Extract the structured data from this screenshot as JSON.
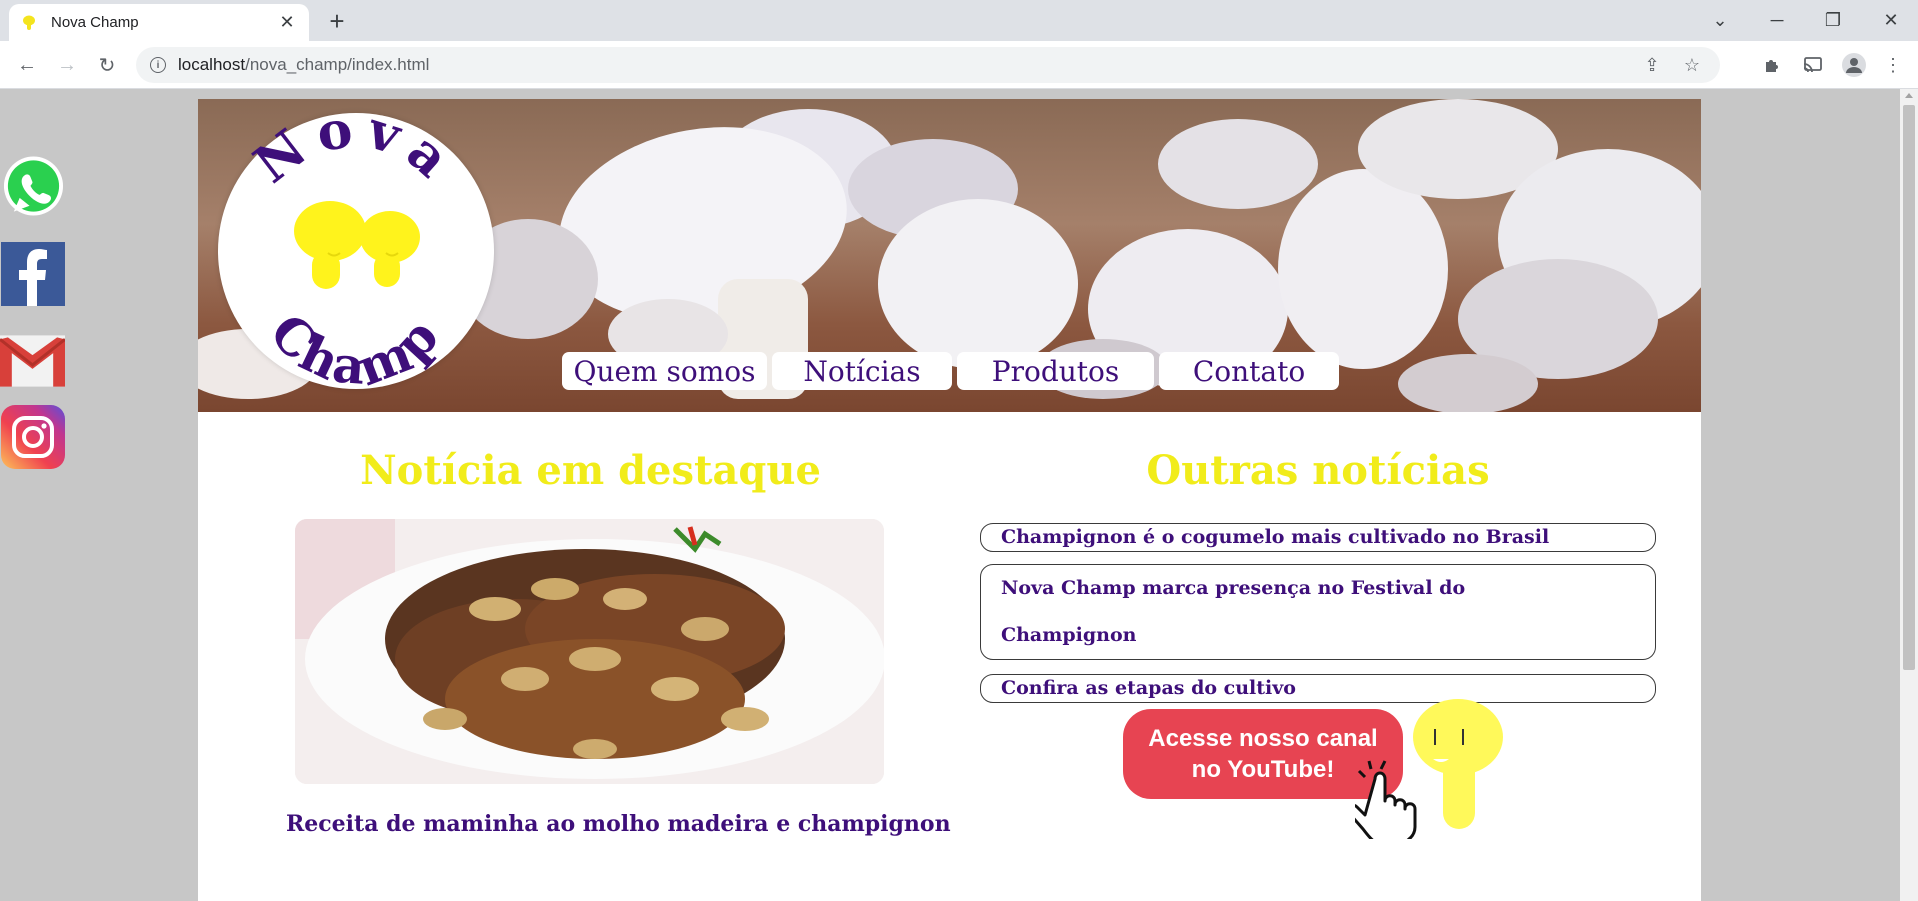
{
  "browser": {
    "tab_title": "Nova Champ",
    "url_host": "localhost",
    "url_path": "/nova_champ/index.html"
  },
  "logo": {
    "top_text": "Nova",
    "bottom_text": "Champ"
  },
  "nav": {
    "items": [
      "Quem somos",
      "Notícias",
      "Produtos",
      "Contato"
    ]
  },
  "featured": {
    "heading": "Notícia em destaque",
    "caption": "Receita de maminha ao molho madeira e champignon"
  },
  "other_news": {
    "heading": "Outras notícias",
    "items": [
      "Champignon é o cogumelo mais cultivado no Brasil",
      "Nova Champ marca presença no Festival do Champignon",
      "Confira as etapas do cultivo"
    ]
  },
  "youtube": {
    "line1": "Acesse nosso canal",
    "line2": "no YouTube!"
  },
  "social": [
    "whatsapp-icon",
    "facebook-icon",
    "gmail-icon",
    "instagram-icon"
  ],
  "colors": {
    "accent_purple": "#3e0f7a",
    "title_yellow": "#f1ec1a",
    "youtube_red": "#e74452",
    "page_bg": "#c7c7c7"
  }
}
